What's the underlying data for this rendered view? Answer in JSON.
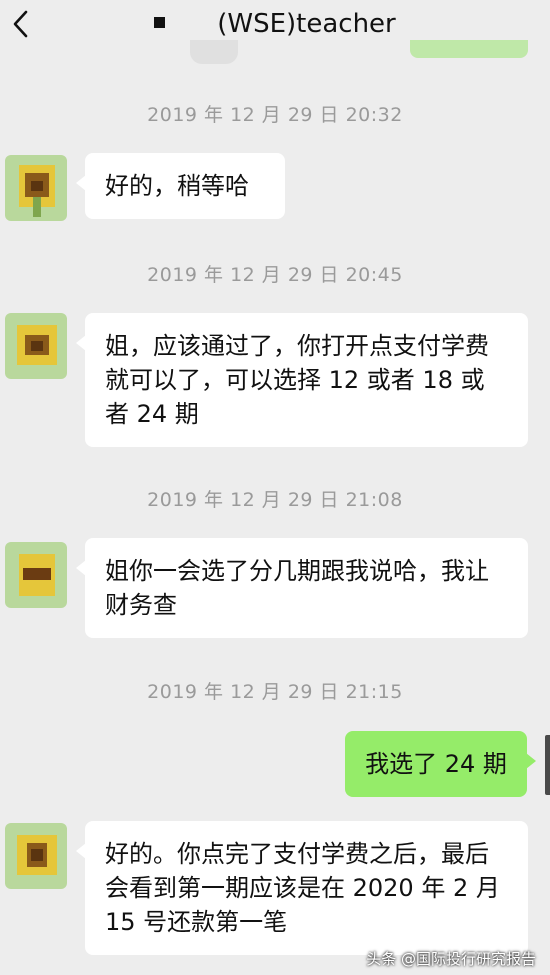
{
  "header": {
    "title": "(WSE)teacher"
  },
  "messages": [
    {
      "time": "2019 年 12 月 29 日 20:32",
      "from": "other",
      "text": "好的，稍等哈"
    },
    {
      "time": "2019 年 12 月 29 日 20:45",
      "from": "other",
      "text": "姐，应该通过了，你打开点支付学费就可以了，可以选择 12 或者 18 或者 24 期"
    },
    {
      "time": "2019 年 12 月 29 日 21:08",
      "from": "other",
      "text": "姐你一会选了分几期跟我说哈，我让财务查"
    },
    {
      "time": "2019 年 12 月 29 日 21:15",
      "from": "me",
      "text": "我选了 24 期"
    },
    {
      "from": "other",
      "text": "好的。你点完了支付学费之后，最后会看到第一期应该是在 2020 年 2 月 15 号还款第一笔"
    }
  ],
  "watermark": "头条 @国际投行研究报告",
  "colors": {
    "background": "#ededed",
    "incoming_bubble": "#ffffff",
    "outgoing_bubble": "#95ec69",
    "timestamp": "#9a9a9a"
  },
  "icons": {
    "back": "chevron-left-icon",
    "avatar": "sunflower-avatar"
  }
}
